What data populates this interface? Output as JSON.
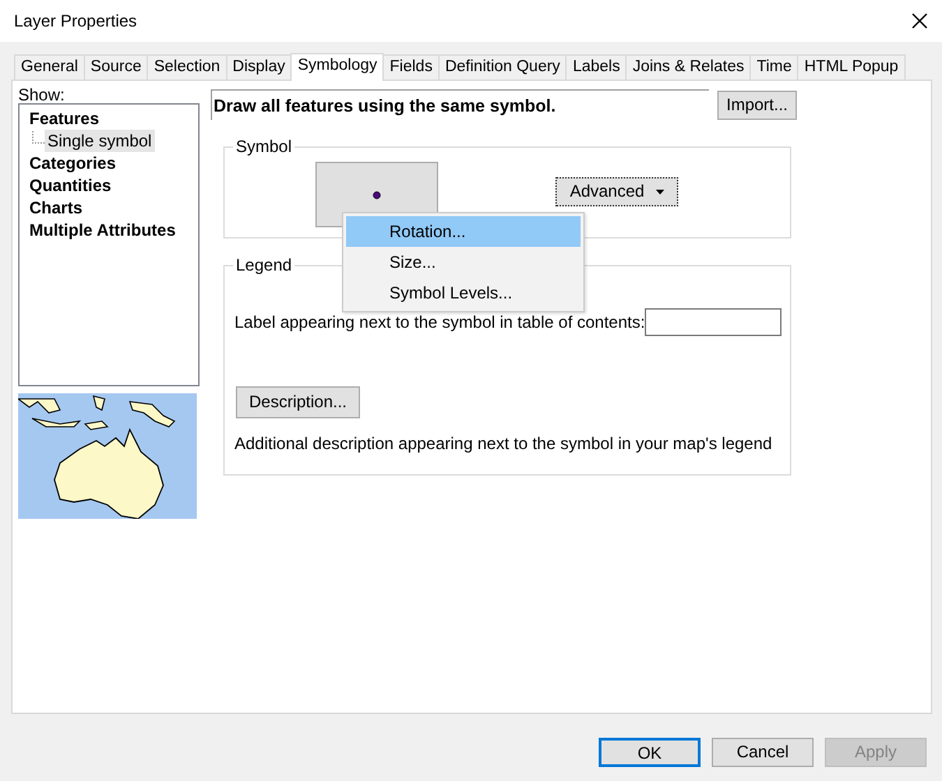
{
  "window": {
    "title": "Layer Properties"
  },
  "tabs": [
    {
      "label": "General",
      "selected": false
    },
    {
      "label": "Source",
      "selected": false
    },
    {
      "label": "Selection",
      "selected": false
    },
    {
      "label": "Display",
      "selected": false
    },
    {
      "label": "Symbology",
      "selected": true
    },
    {
      "label": "Fields",
      "selected": false
    },
    {
      "label": "Definition Query",
      "selected": false
    },
    {
      "label": "Labels",
      "selected": false
    },
    {
      "label": "Joins & Relates",
      "selected": false
    },
    {
      "label": "Time",
      "selected": false
    },
    {
      "label": "HTML Popup",
      "selected": false
    }
  ],
  "show": {
    "label": "Show:",
    "items": [
      {
        "label": "Features",
        "selected": false,
        "children": [
          {
            "label": "Single symbol",
            "selected": true
          }
        ]
      },
      {
        "label": "Categories",
        "selected": false
      },
      {
        "label": "Quantities",
        "selected": false
      },
      {
        "label": "Charts",
        "selected": false
      },
      {
        "label": "Multiple Attributes",
        "selected": false
      }
    ]
  },
  "description": "Draw all features using the same symbol.",
  "import_button": "Import...",
  "symbol_group": {
    "title": "Symbol",
    "advanced_button": "Advanced",
    "menu": [
      {
        "label": "Rotation...",
        "selected": true
      },
      {
        "label": "Size...",
        "selected": false
      },
      {
        "label": "Symbol Levels...",
        "selected": false
      }
    ]
  },
  "legend_group": {
    "title": "Legend",
    "label_prompt": "Label appearing next to the symbol in table of contents:",
    "description_button": "Description...",
    "note": "Additional description appearing next to the symbol in your map's legend"
  },
  "buttons": [
    {
      "label": "OK",
      "kind": "default",
      "disabled": false
    },
    {
      "label": "Cancel",
      "kind": "normal",
      "disabled": false
    },
    {
      "label": "Apply",
      "kind": "normal",
      "disabled": true
    }
  ]
}
